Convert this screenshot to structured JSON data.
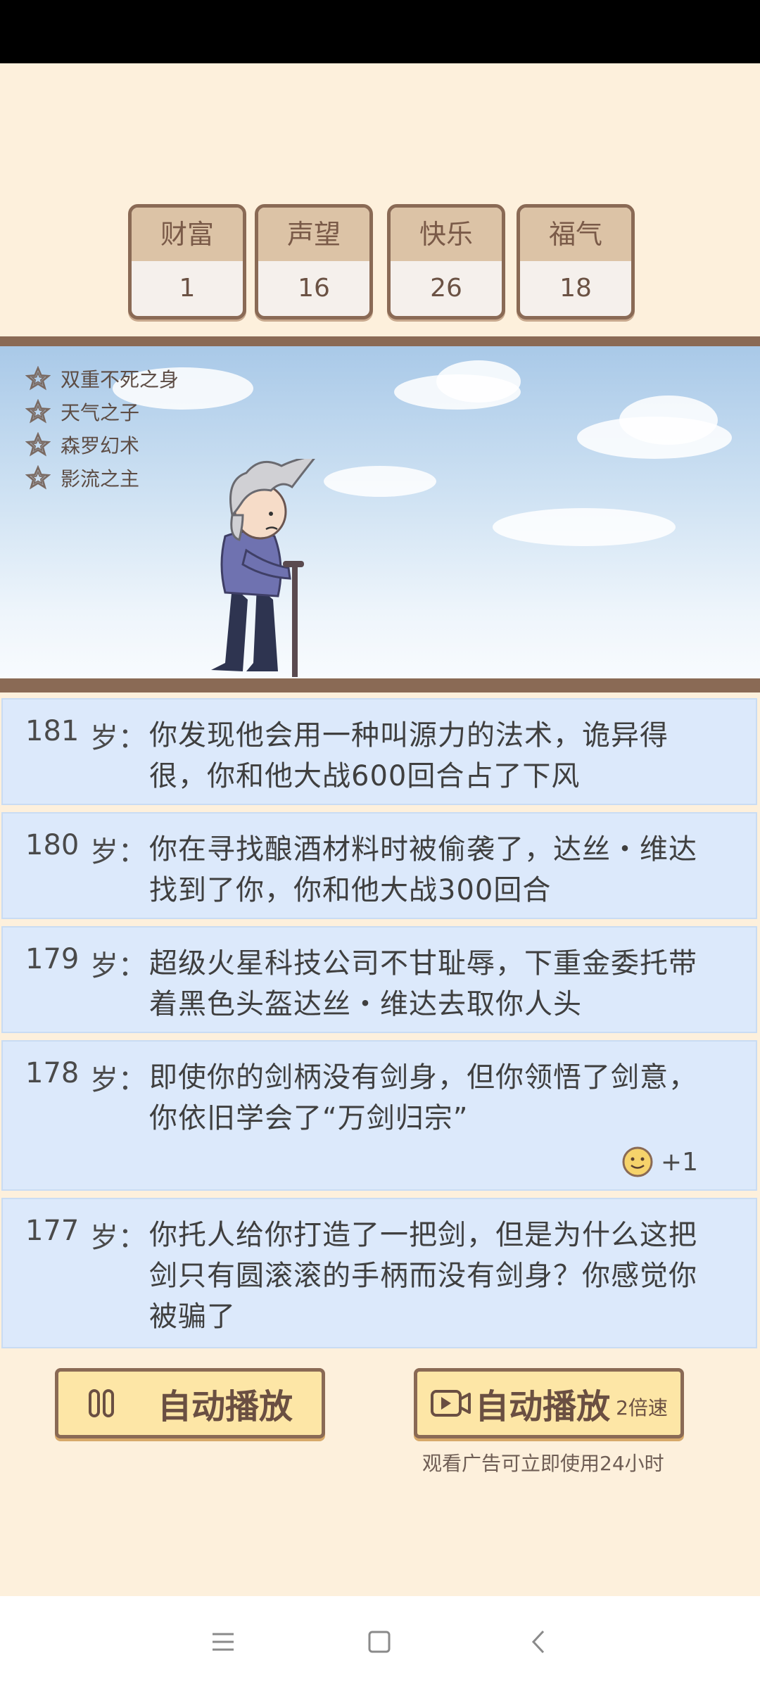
{
  "stats": [
    {
      "label": "财富",
      "value": "1"
    },
    {
      "label": "声望",
      "value": "16"
    },
    {
      "label": "快乐",
      "value": "26"
    },
    {
      "label": "福气",
      "value": "18"
    }
  ],
  "traits": [
    {
      "label": "双重不死之身",
      "icon": "star-outline-icon"
    },
    {
      "label": "天气之子",
      "icon": "star-outline-icon"
    },
    {
      "label": "森罗幻术",
      "icon": "star-outline-icon"
    },
    {
      "label": "影流之主",
      "icon": "star-outline-icon"
    }
  ],
  "log": [
    {
      "age": "181",
      "sui": "岁：",
      "text": "你发现他会用一种叫源力的法术，诡异得很，你和他大战600回合占了下风"
    },
    {
      "age": "180",
      "sui": "岁：",
      "text": "你在寻找酿酒材料时被偷袭了，达丝・维达找到了你，你和他大战300回合"
    },
    {
      "age": "179",
      "sui": "岁：",
      "text": "超级火星科技公司不甘耻辱，下重金委托带着黑色头盔达丝・维达去取你人头"
    },
    {
      "age": "178",
      "sui": "岁：",
      "text": "即使你的剑柄没有剑身，但你领悟了剑意，你依旧学会了“万剑归宗”",
      "reward": "+1",
      "reward_icon": "smiley-face-icon"
    },
    {
      "age": "177",
      "sui": "岁：",
      "text": "你托人给你打造了一把剑，但是为什么这把剑只有圆滚滚的手柄而没有剑身？你感觉你被骗了"
    }
  ],
  "controls": {
    "autoplay_label": "自动播放",
    "autoplay_ad_label": "自动播放",
    "speed_label": "2倍速",
    "ad_note": "观看广告可立即使用24小时"
  },
  "colors": {
    "background": "#fdf0dc",
    "border": "#8a6a55",
    "entry_bg": "#dce9fb",
    "button_bg": "#fde6a6"
  }
}
